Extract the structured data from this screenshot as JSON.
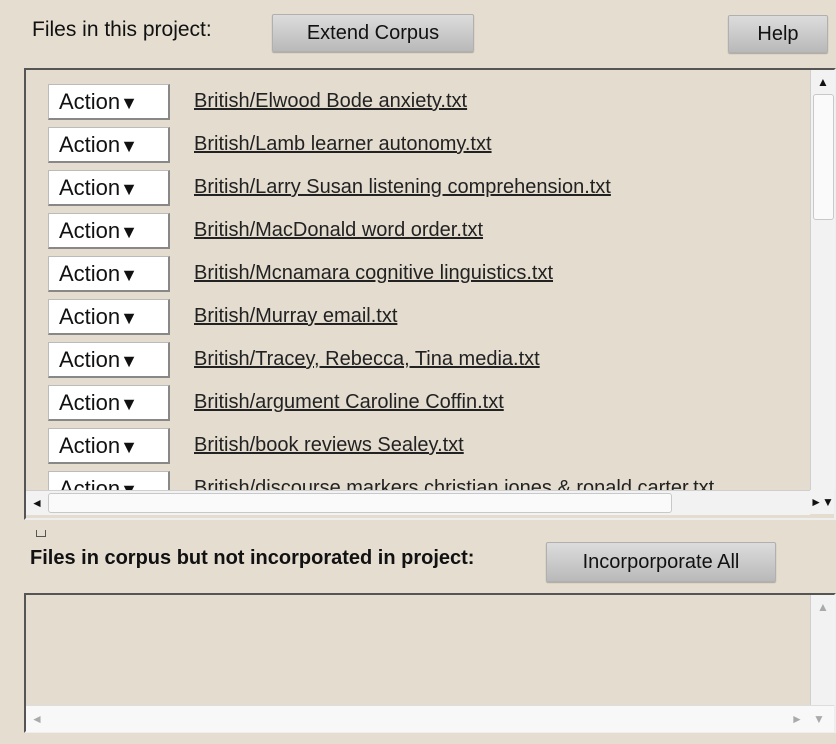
{
  "header": {
    "files_label": "Files in this project:",
    "extend_button": "Extend Corpus",
    "help_button": "Help"
  },
  "project_files": {
    "action_label": "Action",
    "action_arrow": "▼",
    "items": [
      "British/Elwood Bode anxiety.txt",
      "British/Lamb learner autonomy.txt",
      "British/Larry Susan listening comprehension.txt",
      "British/MacDonald word order.txt",
      "British/Mcnamara cognitive linguistics.txt",
      "British/Murray email.txt",
      "British/Tracey, Rebecca, Tina media.txt",
      "British/argument Caroline Coffin.txt",
      "British/book reviews Sealey.txt",
      "British/discourse markers christian jones & ronald carter.txt"
    ]
  },
  "corpus_section": {
    "label": "Files in corpus but not incorporated in project:",
    "incorporate_button": "Incorporporate All"
  },
  "scrollbar": {
    "up_arrow": "▲",
    "left_arrow": "◄",
    "right_arrow": "►",
    "down_arrow": "▼"
  }
}
